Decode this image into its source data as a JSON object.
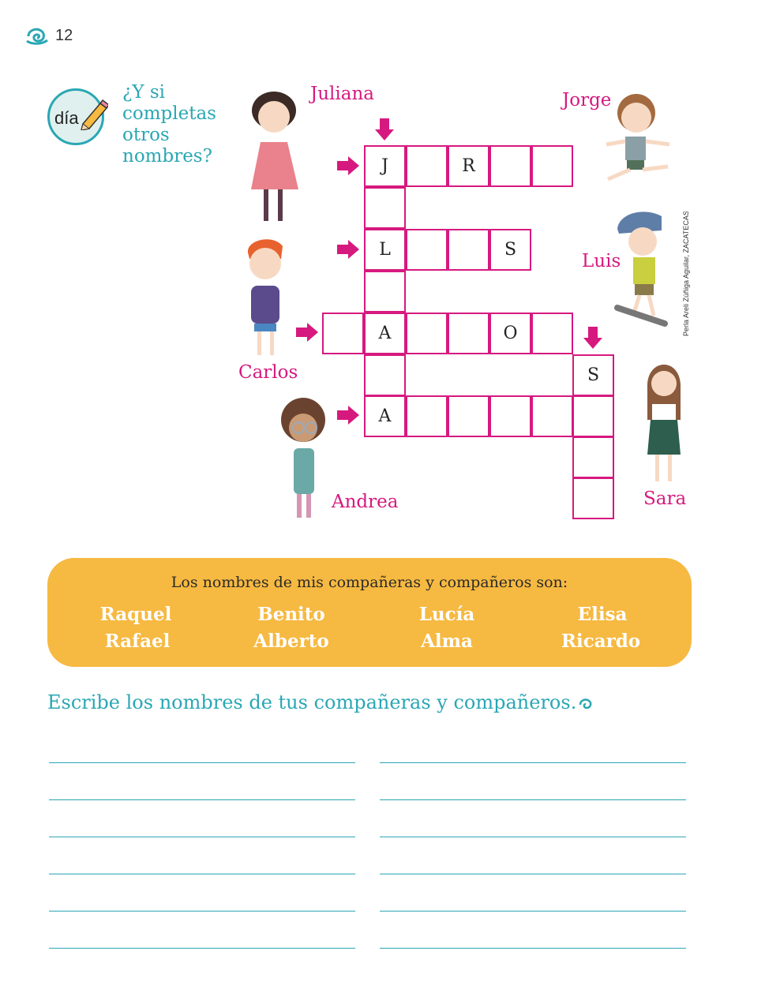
{
  "page": {
    "number": "12"
  },
  "activity": {
    "badge_label": "día",
    "prompt": "¿Y si completas otros nombres?"
  },
  "characters": {
    "juliana": "Juliana",
    "jorge": "Jorge",
    "luis": "Luis",
    "carlos": "Carlos",
    "andrea": "Andrea",
    "sara": "Sara"
  },
  "crossword": {
    "row1": [
      "J",
      "",
      "R",
      "",
      ""
    ],
    "row3": [
      "L",
      "",
      "",
      "S"
    ],
    "row5": [
      "",
      "A",
      "",
      "",
      "O",
      ""
    ],
    "row6_end": "S",
    "row7": [
      "A",
      "",
      "",
      "",
      "",
      ""
    ]
  },
  "credit": "Perla Areli Zúñiga Aguilar, ZACATECAS",
  "classmates_box": {
    "heading": "Los nombres de mis compañeras y compañeros son:",
    "names": [
      [
        "Raquel",
        "Benito",
        "Lucía",
        "Elisa"
      ],
      [
        "Rafael",
        "Alberto",
        "Alma",
        "Ricardo"
      ]
    ]
  },
  "instruction": "Escribe los nombres de tus compañeras y compañeros.",
  "colors": {
    "accent_teal": "#2aa7b4",
    "accent_magenta": "#d6197f",
    "box_yellow": "#f6b941"
  }
}
